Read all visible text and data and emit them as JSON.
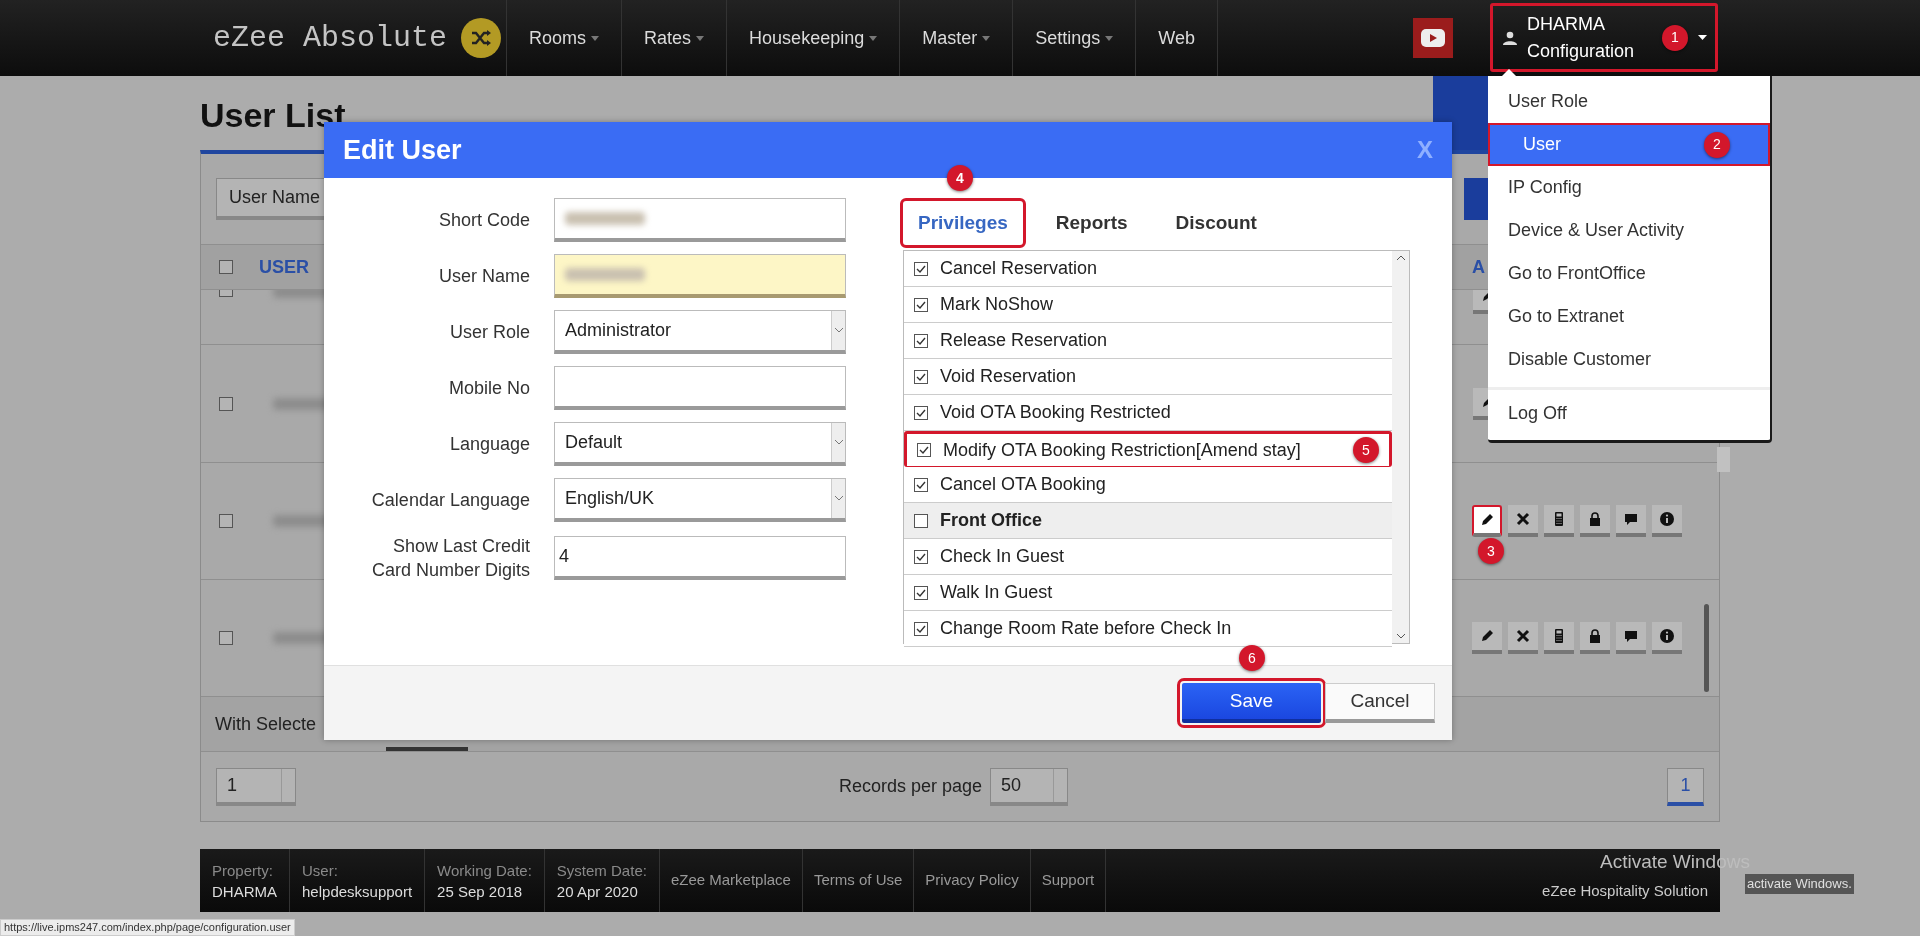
{
  "top_bar": {
    "logo": "eZee Absolute",
    "nav": [
      {
        "label": "Rooms",
        "has_menu": true
      },
      {
        "label": "Rates",
        "has_menu": true
      },
      {
        "label": "Housekeeping",
        "has_menu": true
      },
      {
        "label": "Master",
        "has_menu": true
      },
      {
        "label": "Settings",
        "has_menu": true
      },
      {
        "label": "Web",
        "has_menu": false
      }
    ],
    "user_menu": {
      "name": "DHARMA",
      "subtitle": "Configuration",
      "badge": "1",
      "highlighted": true
    }
  },
  "user_dropdown": {
    "items": [
      {
        "label": "User Role",
        "selected": false,
        "highlighted": false,
        "separated": false
      },
      {
        "label": "User",
        "selected": true,
        "highlighted": true,
        "badge": "2",
        "separated": false
      },
      {
        "label": "IP Config",
        "selected": false,
        "highlighted": false,
        "separated": false
      },
      {
        "label": "Device & User Activity",
        "selected": false,
        "highlighted": false,
        "separated": false
      },
      {
        "label": "Go to FrontOffice",
        "selected": false,
        "highlighted": false,
        "separated": false
      },
      {
        "label": "Go to Extranet",
        "selected": false,
        "highlighted": false,
        "separated": false
      },
      {
        "label": "Disable Customer",
        "selected": false,
        "highlighted": false,
        "separated": false
      },
      {
        "label": "Log Off",
        "selected": false,
        "highlighted": false,
        "separated": true
      }
    ]
  },
  "page": {
    "title": "User List",
    "filter_select": "User Name",
    "select_all_checked": false,
    "columns": [
      "USER",
      "A"
    ],
    "rows": [
      {
        "kind": "partial",
        "checked": false,
        "edit_highlighted": false
      },
      {
        "kind": "covered",
        "checked": false,
        "edit_highlighted": false
      },
      {
        "kind": "full",
        "checked": false,
        "edit_highlighted": true,
        "edit_badge": "3"
      },
      {
        "kind": "full",
        "checked": false,
        "edit_highlighted": false
      }
    ],
    "with_selected": "With Selecte",
    "pager": {
      "page_select": "1",
      "records_label": "Records per page",
      "records_value": "50",
      "pages": [
        {
          "label": "1",
          "selected": true
        }
      ]
    }
  },
  "modal": {
    "title": "Edit User",
    "close": "X",
    "fields": [
      {
        "label": "Short Code",
        "kind": "blurred",
        "focused": false
      },
      {
        "label": "User Name",
        "kind": "blurred",
        "focused": true
      },
      {
        "label": "User Role",
        "kind": "select",
        "value": "Administrator",
        "focused": false
      },
      {
        "label": "Mobile No",
        "kind": "text",
        "focused": false
      },
      {
        "label": "Language",
        "kind": "select",
        "value": "Default",
        "focused": false
      },
      {
        "label": "Calendar Language",
        "kind": "select",
        "value": "English/UK",
        "focused": false
      },
      {
        "label": "Show Last Credit Card Number Digits",
        "kind": "text",
        "value": "4",
        "focused": false
      }
    ],
    "tabs": [
      {
        "label": "Privileges",
        "selected": true,
        "highlighted": true,
        "badge": "4"
      },
      {
        "label": "Reports",
        "selected": false,
        "highlighted": false
      },
      {
        "label": "Discount",
        "selected": false,
        "highlighted": false
      }
    ],
    "privileges": [
      {
        "label": "Cancel Reservation",
        "kind": "item",
        "checked": true,
        "highlighted": false
      },
      {
        "label": "Mark NoShow",
        "kind": "item",
        "checked": true,
        "highlighted": false
      },
      {
        "label": "Release Reservation",
        "kind": "item",
        "checked": true,
        "highlighted": false
      },
      {
        "label": "Void Reservation",
        "kind": "item",
        "checked": true,
        "highlighted": false
      },
      {
        "label": "Void OTA Booking Restricted",
        "kind": "item",
        "checked": true,
        "highlighted": false
      },
      {
        "label": "Modify OTA Booking Restriction[Amend stay]",
        "kind": "item",
        "checked": true,
        "highlighted": true,
        "badge": "5"
      },
      {
        "label": "Cancel OTA Booking",
        "kind": "item",
        "checked": true,
        "highlighted": false
      },
      {
        "label": "Front Office",
        "kind": "group",
        "checked": false,
        "highlighted": false
      },
      {
        "label": "Check In Guest",
        "kind": "item",
        "checked": true,
        "highlighted": false
      },
      {
        "label": "Walk In Guest",
        "kind": "item",
        "checked": true,
        "highlighted": false
      },
      {
        "label": "Change Room Rate before Check In",
        "kind": "item",
        "checked": true,
        "highlighted": false
      }
    ],
    "buttons": [
      {
        "label": "Save",
        "kind": "primary",
        "highlighted": true,
        "badge": "6"
      },
      {
        "label": "Cancel",
        "kind": "secondary",
        "highlighted": false
      }
    ]
  },
  "footer": {
    "info": [
      {
        "label": "Property:",
        "value": "DHARMA"
      },
      {
        "label": "User:",
        "value": "helpdesksupport"
      },
      {
        "label": "Working Date:",
        "value": "25 Sep 2018"
      },
      {
        "label": "System Date:",
        "value": "20 Apr 2020"
      }
    ],
    "links": [
      "eZee Marketplace",
      "Terms of Use",
      "Privacy Policy",
      "Support"
    ],
    "brand": "eZee Hospitality Solution"
  },
  "windows_notice": [
    "Activate Windows",
    "activate Windows."
  ],
  "status_url": "https://live.ipms247.com/index.php/page/configuration.user"
}
